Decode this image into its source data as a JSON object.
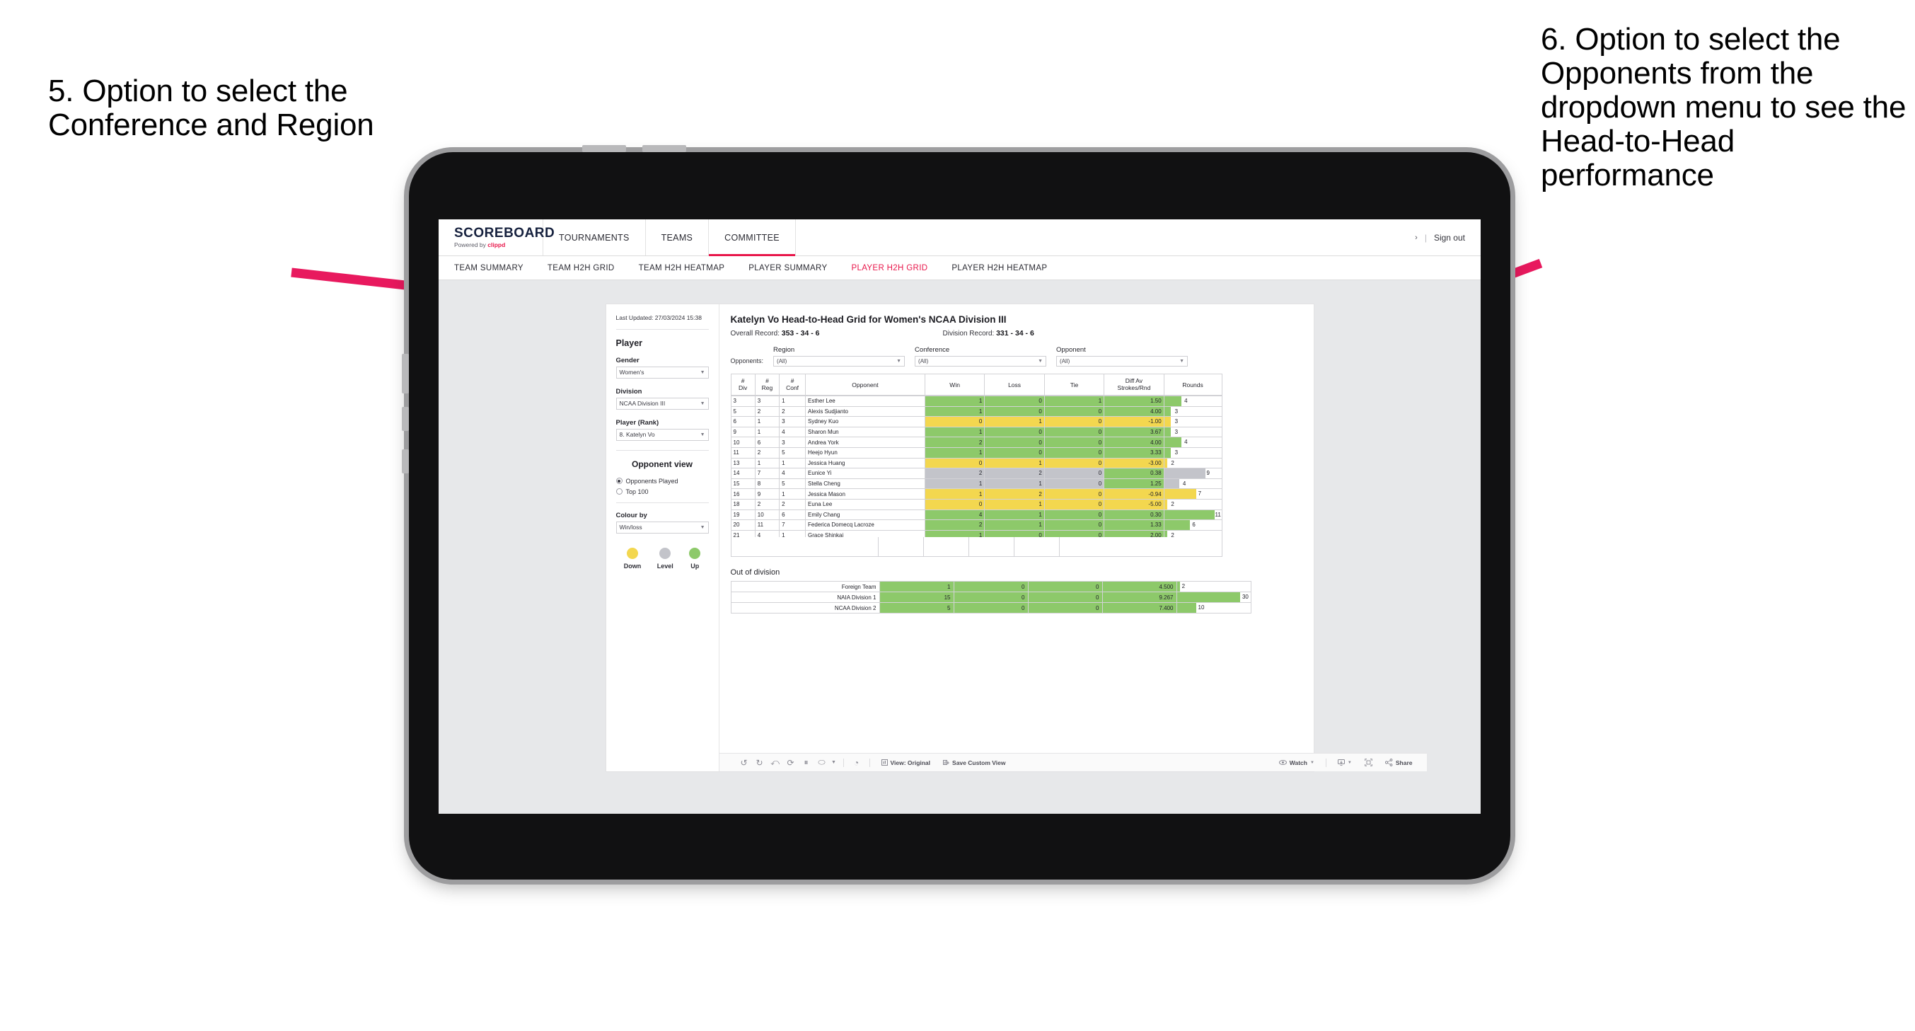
{
  "annotations": {
    "left": "5. Option to select the Conference and Region",
    "right": "6. Option to select the Opponents from the dropdown menu to see the Head-to-Head performance",
    "arrow_color": "#e8195e"
  },
  "app": {
    "logo": {
      "word": "SCOREBOARD",
      "powered_prefix": "Powered by ",
      "brand": "clippd"
    },
    "top_nav": [
      {
        "label": "TOURNAMENTS",
        "active": false
      },
      {
        "label": "TEAMS",
        "active": false
      },
      {
        "label": "COMMITTEE",
        "active": true
      }
    ],
    "header_right": {
      "chevron": "›",
      "separator": "|",
      "sign_out": "Sign out"
    },
    "sub_nav": [
      {
        "label": "TEAM SUMMARY",
        "active": false
      },
      {
        "label": "TEAM H2H GRID",
        "active": false
      },
      {
        "label": "TEAM H2H HEATMAP",
        "active": false
      },
      {
        "label": "PLAYER SUMMARY",
        "active": false
      },
      {
        "label": "PLAYER H2H GRID",
        "active": true
      },
      {
        "label": "PLAYER H2H HEATMAP",
        "active": false
      }
    ],
    "accent": "#e8174b"
  },
  "sidebar": {
    "last_updated": "Last Updated: 27/03/2024 15:38",
    "player_heading": "Player",
    "gender": {
      "label": "Gender",
      "value": "Women's"
    },
    "division": {
      "label": "Division",
      "value": "NCAA Division III"
    },
    "player_rank": {
      "label": "Player (Rank)",
      "value": "8. Katelyn Vo"
    },
    "opponent_view": {
      "heading": "Opponent view",
      "options": [
        {
          "label": "Opponents Played",
          "selected": true
        },
        {
          "label": "Top 100",
          "selected": false
        }
      ]
    },
    "colour_by": {
      "label": "Colour by",
      "value": "Win/loss"
    },
    "legend": [
      {
        "label": "Down",
        "color": "#f3d74f"
      },
      {
        "label": "Level",
        "color": "#c3c4ca"
      },
      {
        "label": "Up",
        "color": "#8dc96a"
      }
    ]
  },
  "main": {
    "title": "Katelyn Vo Head-to-Head Grid for Women's NCAA Division III",
    "overall_record_label": "Overall Record: ",
    "overall_record_value": "353 - 34 - 6",
    "division_record_label": "Division Record: ",
    "division_record_value": "331 -  34 - 6",
    "opponents_label": "Opponents:",
    "filters": [
      {
        "label": "Region",
        "value": "(All)"
      },
      {
        "label": "Conference",
        "value": "(All)"
      },
      {
        "label": "Opponent",
        "value": "(All)"
      }
    ],
    "grid_headers": [
      {
        "top": "#",
        "bottom": "Div"
      },
      {
        "top": "#",
        "bottom": "Reg"
      },
      {
        "top": "#",
        "bottom": "Conf"
      },
      {
        "top": "",
        "bottom": "Opponent"
      },
      {
        "top": "",
        "bottom": "Win"
      },
      {
        "top": "",
        "bottom": "Loss"
      },
      {
        "top": "",
        "bottom": "Tie"
      },
      {
        "top": "Diff Av",
        "bottom": "Strokes/Rnd"
      },
      {
        "top": "",
        "bottom": "Rounds"
      }
    ],
    "grid_rows": [
      {
        "div": "3",
        "reg": "3",
        "conf": "1",
        "opponent": "Esther Lee",
        "win": "1",
        "loss": "0",
        "tie": "1",
        "diff": "1.50",
        "rounds": "4",
        "color": "#8dc96a",
        "bar_pct": 30
      },
      {
        "div": "5",
        "reg": "2",
        "conf": "2",
        "opponent": "Alexis Sudjianto",
        "win": "1",
        "loss": "0",
        "tie": "0",
        "diff": "4.00",
        "rounds": "3",
        "color": "#8dc96a",
        "bar_pct": 12
      },
      {
        "div": "6",
        "reg": "1",
        "conf": "3",
        "opponent": "Sydney Kuo",
        "win": "0",
        "loss": "1",
        "tie": "0",
        "diff": "-1.00",
        "rounds": "3",
        "color": "#f3d74f",
        "bar_pct": 12
      },
      {
        "div": "9",
        "reg": "1",
        "conf": "4",
        "opponent": "Sharon Mun",
        "win": "1",
        "loss": "0",
        "tie": "0",
        "diff": "3.67",
        "rounds": "3",
        "color": "#8dc96a",
        "bar_pct": 12
      },
      {
        "div": "10",
        "reg": "6",
        "conf": "3",
        "opponent": "Andrea York",
        "win": "2",
        "loss": "0",
        "tie": "0",
        "diff": "4.00",
        "rounds": "4",
        "color": "#8dc96a",
        "bar_pct": 30
      },
      {
        "div": "11",
        "reg": "2",
        "conf": "5",
        "opponent": "Heejo Hyun",
        "win": "1",
        "loss": "0",
        "tie": "0",
        "diff": "3.33",
        "rounds": "3",
        "color": "#8dc96a",
        "bar_pct": 12
      },
      {
        "div": "13",
        "reg": "1",
        "conf": "1",
        "opponent": "Jessica Huang",
        "win": "0",
        "loss": "1",
        "tie": "0",
        "diff": "-3.00",
        "rounds": "2",
        "color": "#f3d74f",
        "bar_pct": 5
      },
      {
        "div": "14",
        "reg": "7",
        "conf": "4",
        "opponent": "Eunice Yi",
        "win": "2",
        "loss": "2",
        "tie": "0",
        "diff": "0.38",
        "rounds": "9",
        "color": "#c3c4ca",
        "bar_pct": 72,
        "diff_color": "#8dc96a"
      },
      {
        "div": "15",
        "reg": "8",
        "conf": "5",
        "opponent": "Stella Cheng",
        "win": "1",
        "loss": "1",
        "tie": "0",
        "diff": "1.25",
        "rounds": "4",
        "color": "#c3c4ca",
        "bar_pct": 27,
        "diff_color": "#8dc96a"
      },
      {
        "div": "16",
        "reg": "9",
        "conf": "1",
        "opponent": "Jessica Mason",
        "win": "1",
        "loss": "2",
        "tie": "0",
        "diff": "-0.94",
        "rounds": "7",
        "color": "#f3d74f",
        "bar_pct": 56
      },
      {
        "div": "18",
        "reg": "2",
        "conf": "2",
        "opponent": "Euna Lee",
        "win": "0",
        "loss": "1",
        "tie": "0",
        "diff": "-5.00",
        "rounds": "2",
        "color": "#f3d74f",
        "bar_pct": 5
      },
      {
        "div": "19",
        "reg": "10",
        "conf": "6",
        "opponent": "Emily Chang",
        "win": "4",
        "loss": "1",
        "tie": "0",
        "diff": "0.30",
        "rounds": "11",
        "color": "#8dc96a",
        "bar_pct": 88
      },
      {
        "div": "20",
        "reg": "11",
        "conf": "7",
        "opponent": "Federica Domecq Lacroze",
        "win": "2",
        "loss": "1",
        "tie": "0",
        "diff": "1.33",
        "rounds": "6",
        "color": "#8dc96a",
        "bar_pct": 45
      }
    ],
    "out_of_division": {
      "title": "Out of division",
      "rows": [
        {
          "label": "Foreign Team",
          "win": "1",
          "loss": "0",
          "tie": "0",
          "diff": "4.500",
          "rounds": "2",
          "color": "#8dc96a",
          "bar_pct": 4
        },
        {
          "label": "NAIA Division 1",
          "win": "15",
          "loss": "0",
          "tie": "0",
          "diff": "9.267",
          "rounds": "30",
          "color": "#8dc96a",
          "bar_pct": 86
        },
        {
          "label": "NCAA Division 2",
          "win": "5",
          "loss": "0",
          "tie": "0",
          "diff": "7.400",
          "rounds": "10",
          "color": "#8dc96a",
          "bar_pct": 26
        }
      ]
    }
  },
  "toolbar": {
    "icons": [
      "undo-icon",
      "redo-icon",
      "revert-icon",
      "refresh-icon",
      "pause-icon",
      "pan-icon"
    ],
    "view_label": "View: Original",
    "save_label": "Save Custom View",
    "watch_label": "Watch",
    "share_label": "Share"
  }
}
